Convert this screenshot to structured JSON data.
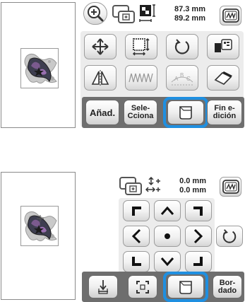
{
  "top": {
    "size_readout": {
      "width": "87.3 mm",
      "height": "89.2 mm"
    },
    "buttons": {
      "add": "Añad.",
      "select_line1": "Sele-",
      "select_line2": "Cciona",
      "end_line1": "Fin e-",
      "end_line2": "dición"
    }
  },
  "bottom": {
    "move_readout": {
      "vertical": "0.0 mm",
      "horizontal": "0.0 mm"
    },
    "buttons": {
      "embroider_line1": "Bor-",
      "embroider_line2": "dado"
    }
  },
  "colors": {
    "highlight": "#1f8fe0",
    "button_bar": "#6e6e6e"
  }
}
